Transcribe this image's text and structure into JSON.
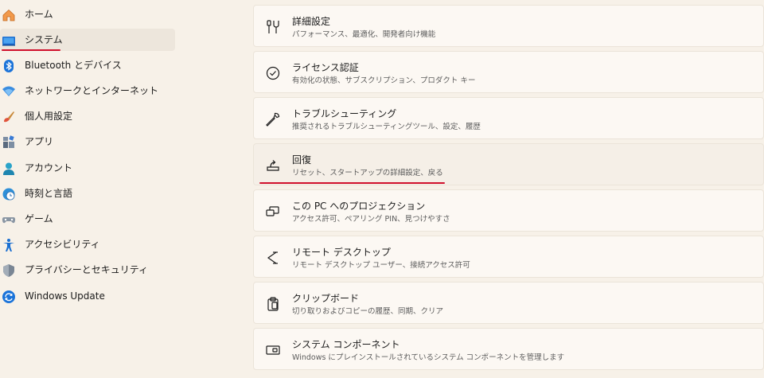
{
  "sidebar": {
    "items": [
      {
        "label": "ホーム",
        "icon": "home-icon"
      },
      {
        "label": "システム",
        "icon": "system-monitor-icon"
      },
      {
        "label": "Bluetooth とデバイス",
        "icon": "bluetooth-icon"
      },
      {
        "label": "ネットワークとインターネット",
        "icon": "wifi-icon"
      },
      {
        "label": "個人用設定",
        "icon": "brush-icon"
      },
      {
        "label": "アプリ",
        "icon": "apps-icon"
      },
      {
        "label": "アカウント",
        "icon": "account-icon"
      },
      {
        "label": "時刻と言語",
        "icon": "globe-clock-icon"
      },
      {
        "label": "ゲーム",
        "icon": "gamepad-icon"
      },
      {
        "label": "アクセシビリティ",
        "icon": "accessibility-icon"
      },
      {
        "label": "プライバシーとセキュリティ",
        "icon": "shield-icon"
      },
      {
        "label": "Windows Update",
        "icon": "windows-update-icon"
      }
    ],
    "selected": "システム"
  },
  "main": {
    "cards": [
      {
        "title": "詳細設定",
        "subtitle": "パフォーマンス、最適化、開発者向け機能",
        "icon": "advanced-settings-icon"
      },
      {
        "title": "ライセンス認証",
        "subtitle": "有効化の状態、サブスクリプション、プロダクト キー",
        "icon": "check-circle-icon"
      },
      {
        "title": "トラブルシューティング",
        "subtitle": "推奨されるトラブルシューティングツール、設定、履歴",
        "icon": "wrench-icon"
      },
      {
        "title": "回復",
        "subtitle": "リセット、スタートアップの詳細設定、戻る",
        "icon": "recovery-icon"
      },
      {
        "title": "この PC へのプロジェクション",
        "subtitle": "アクセス許可、ペアリング PIN、見つけやすさ",
        "icon": "projection-icon"
      },
      {
        "title": "リモート デスクトップ",
        "subtitle": "リモート デスクトップ ユーザー、接続アクセス許可",
        "icon": "remote-desktop-icon"
      },
      {
        "title": "クリップボード",
        "subtitle": "切り取りおよびコピーの履歴、同期、クリア",
        "icon": "clipboard-icon"
      },
      {
        "title": "システム コンポーネント",
        "subtitle": "Windows にプレインストールされているシステム コンポーネントを管理します",
        "icon": "system-components-icon"
      }
    ]
  },
  "colors": {
    "accent_underline": "#d0102c",
    "background": "#f7f1e8",
    "card": "#fcf8f3"
  }
}
